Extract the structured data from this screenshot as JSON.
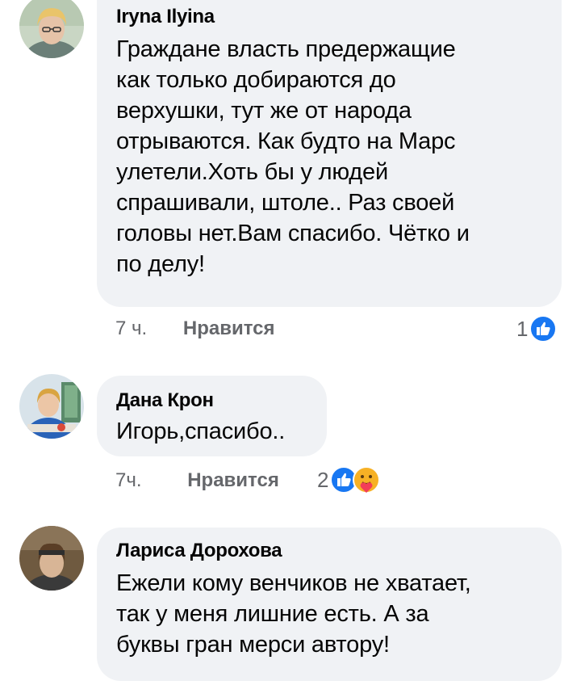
{
  "comments": [
    {
      "author": "Iryna Ilyina",
      "text": "Граждане власть предержащие\nкак только добираются до\nверхушки, тут же от народа\nотрываются. Как будто на Марс\nулетели.Хоть бы у людей\nспрашивали, штоле.. Раз своей\nголовы нет.Вам спасибо. Чётко и\nпо делу!",
      "time": "7 ч.",
      "like_label": "Нравится",
      "reaction_count": "1",
      "reactions": [
        "like-reaction-icon"
      ]
    },
    {
      "author": "Дана Крон",
      "text": "Игорь,спасибо..",
      "time": "7ч.",
      "like_label": "Нравится",
      "reaction_count": "2",
      "reactions": [
        "like-reaction-icon",
        "care-reaction-icon"
      ]
    },
    {
      "author": "Лариса Дорохова",
      "text": "Ежели кому венчиков не хватает,\nтак у меня лишние есть. А за\nбуквы гран мерси автору!"
    }
  ],
  "colors": {
    "bubble": "#f0f2f5",
    "text": "#050505",
    "meta": "#65676b",
    "like_blue": "#1877f2",
    "care_yellow": "#f7b125"
  }
}
